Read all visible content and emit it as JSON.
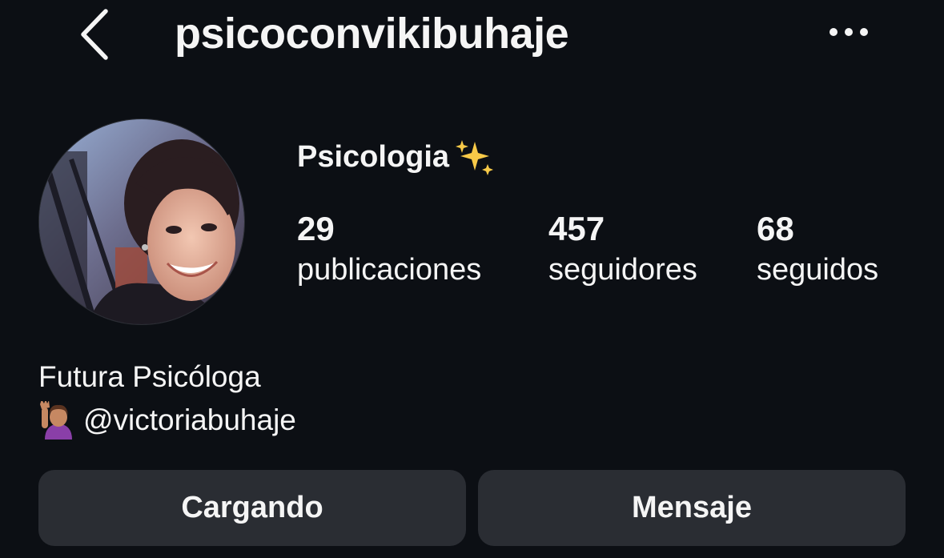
{
  "header": {
    "username": "psicoconvikibuhaje",
    "back_icon": "chevron-left-icon",
    "more_icon": "more-horizontal-icon"
  },
  "profile": {
    "display_name": "Psicologia",
    "display_name_emoji": "sparkles-icon",
    "stats": [
      {
        "value": "29",
        "label": "publicaciones"
      },
      {
        "value": "457",
        "label": "seguidores"
      },
      {
        "value": "68",
        "label": "seguidos"
      }
    ],
    "bio": {
      "line1": "Futura Psicóloga",
      "line2_emoji": "raising-hand-icon",
      "line2_mention": "@victoriabuhaje"
    }
  },
  "actions": {
    "primary_label": "Cargando",
    "secondary_label": "Mensaje"
  },
  "colors": {
    "background": "#0c0f14",
    "text": "#f5f5f5",
    "button_bg": "#2a2d33"
  }
}
